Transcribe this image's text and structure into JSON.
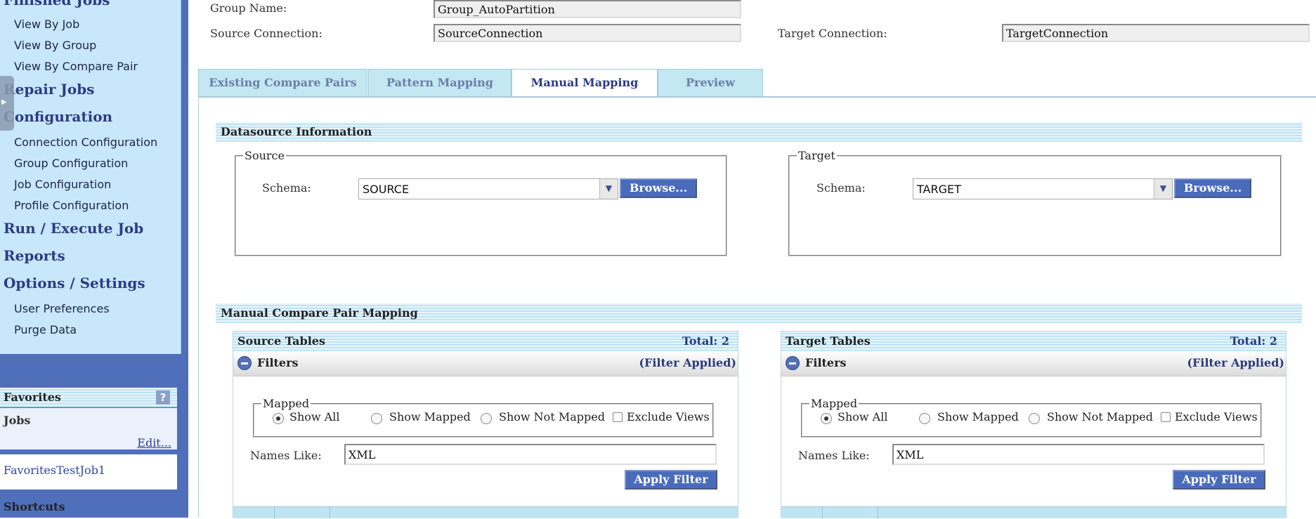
{
  "sidebar": {
    "top_heading": "Finished Jobs",
    "finished_links": [
      "View By Job",
      "View By Group",
      "View By Compare Pair"
    ],
    "repair_jobs": "Repair Jobs",
    "configuration": "Configuration",
    "config_links": [
      "Connection Configuration",
      "Group Configuration",
      "Job Configuration",
      "Profile Configuration"
    ],
    "run_execute": "Run / Execute Job",
    "reports": "Reports",
    "options": "Options / Settings",
    "option_links": [
      "User Preferences",
      "Purge Data"
    ]
  },
  "favorites": {
    "title": "Favorites",
    "help": "?",
    "jobs_label": "Jobs",
    "edit": "Edit...",
    "job_item": "FavoritesTestJob1",
    "shortcuts": "Shortcuts"
  },
  "header": {
    "group_name_label": "Group Name:",
    "group_name_value": "Group_AutoPartition",
    "source_conn_label": "Source Connection:",
    "source_conn_value": "SourceConnection",
    "target_conn_label": "Target Connection:",
    "target_conn_value": "TargetConnection"
  },
  "tabs": [
    {
      "label": "Existing Compare Pairs",
      "active": false
    },
    {
      "label": "Pattern Mapping",
      "active": false
    },
    {
      "label": "Manual Mapping",
      "active": true
    },
    {
      "label": "Preview",
      "active": false
    }
  ],
  "datasource": {
    "title": "Datasource Information",
    "source": {
      "legend": "Source",
      "schema_label": "Schema:",
      "schema_value": "SOURCE",
      "browse": "Browse..."
    },
    "target": {
      "legend": "Target",
      "schema_label": "Schema:",
      "schema_value": "TARGET",
      "browse": "Browse..."
    }
  },
  "manual": {
    "title": "Manual Compare Pair Mapping",
    "source_tables": {
      "title": "Source Tables",
      "total": "Total: 2",
      "filters": "Filters",
      "filter_applied": "(Filter Applied)",
      "mapped_legend": "Mapped",
      "options": [
        "Show All",
        "Show Mapped",
        "Show Not Mapped"
      ],
      "selected_option": "Show All",
      "exclude_views": "Exclude Views",
      "names_like_label": "Names Like:",
      "names_like_value": "XML",
      "apply": "Apply Filter"
    },
    "target_tables": {
      "title": "Target Tables",
      "total": "Total: 2",
      "filters": "Filters",
      "filter_applied": "(Filter Applied)",
      "mapped_legend": "Mapped",
      "options": [
        "Show All",
        "Show Mapped",
        "Show Not Mapped"
      ],
      "selected_option": "Show All",
      "exclude_views": "Exclude Views",
      "names_like_label": "Names Like:",
      "names_like_value": "XML",
      "apply": "Apply Filter"
    }
  },
  "colors": {
    "sidebar_bg": "#4f6fbb",
    "nav_bg": "#c8e7fb",
    "heading": "#2c3b84",
    "button": "#4a6bbb",
    "tab_bg": "#c3e7f3"
  }
}
